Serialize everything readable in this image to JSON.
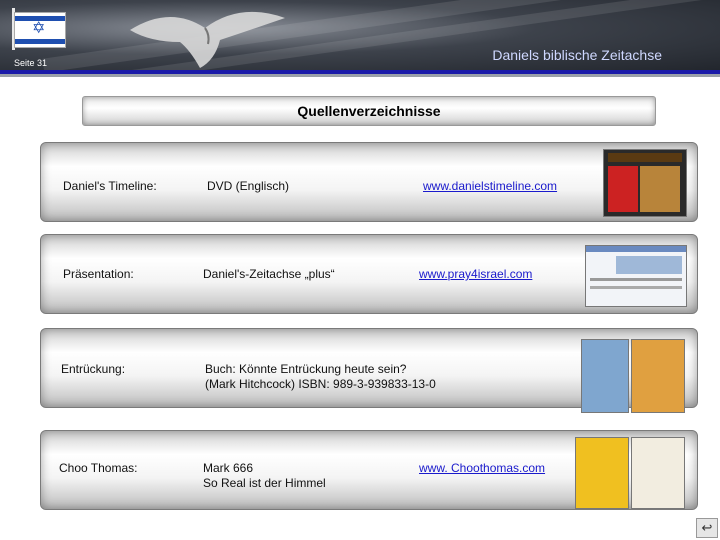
{
  "header": {
    "title": "Daniels biblische Zeitachse",
    "page_label": "Seite 31"
  },
  "section": {
    "title": "Quellenverzeichnisse"
  },
  "rows": [
    {
      "label": "Daniel's Timeline:",
      "desc1": "DVD (Englisch)",
      "desc2": "",
      "link": "www.danielstimeline.com"
    },
    {
      "label": "Präsentation:",
      "desc1": "Daniel's-Zeitachse „plus“",
      "desc2": "",
      "link": "www.pray4israel.com"
    },
    {
      "label": "Entrückung:",
      "desc1": "Buch: Könnte Entrückung heute sein?",
      "desc2": "(Mark Hitchcock) ISBN: 989-3-939833-13-0",
      "link": ""
    },
    {
      "label": "Choo Thomas:",
      "desc1": "Mark 666",
      "desc2": "So Real ist der Himmel",
      "link": "www. Choothomas.com"
    }
  ],
  "icons": {
    "flag": "israel-flag-icon",
    "bird": "eagle-icon",
    "nav": "return-arrow-icon"
  },
  "colors": {
    "blue_rule": "#1a1aa8",
    "link": "#1a1acc"
  }
}
